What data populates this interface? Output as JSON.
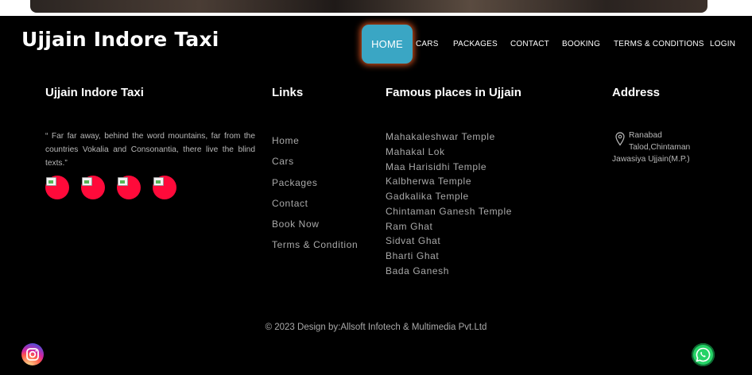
{
  "brand": "Ujjain Indore Taxi",
  "nav": [
    {
      "label": "HOME",
      "active": true
    },
    {
      "label": "CARS"
    },
    {
      "label": "PACKAGES"
    },
    {
      "label": "CONTACT"
    },
    {
      "label": "BOOKING"
    },
    {
      "label": "TERMS & CONDITIONS"
    },
    {
      "label": "LOGIN"
    }
  ],
  "about": {
    "title": "Ujjain Indore Taxi",
    "text": "“ Far far away, behind the word mountains, far from the countries Vokalia and Consonantia, there live the blind texts.”",
    "social_icons": [
      "broken-image-icon",
      "broken-image-icon",
      "broken-image-icon",
      "broken-image-icon"
    ],
    "social_color": "#ff0a3a"
  },
  "links": {
    "title": "Links",
    "items": [
      "Home",
      "Cars",
      "Packages",
      "Contact",
      "Book Now",
      "Terms & Condition"
    ]
  },
  "places": {
    "title": "Famous places in Ujjain",
    "items": [
      "Mahakaleshwar Temple",
      "Mahakal Lok",
      "Maa Harisidhi Temple",
      "Kalbherwa Temple",
      "Gadkalika Temple",
      "Chintaman Ganesh Temple",
      "Ram Ghat",
      "Sidvat Ghat",
      "Bharti Ghat",
      "Bada Ganesh"
    ]
  },
  "address": {
    "title": "Address",
    "icon": "map-pin-icon",
    "line1": "Ranabad",
    "line2": "Talod,Chintaman",
    "line3": "Jawasiya Ujjain(M.P.)"
  },
  "copyright": "© 2023 Design by:Allsoft Infotech & Multimedia Pvt.Ltd",
  "floating": {
    "left_icon": "instagram-icon",
    "right_icon": "whatsapp-icon"
  },
  "colors": {
    "background": "#000000",
    "nav_active": "#3aa6c4",
    "nav_glow": "#d2501e",
    "muted_text": "#a9a9a9"
  }
}
